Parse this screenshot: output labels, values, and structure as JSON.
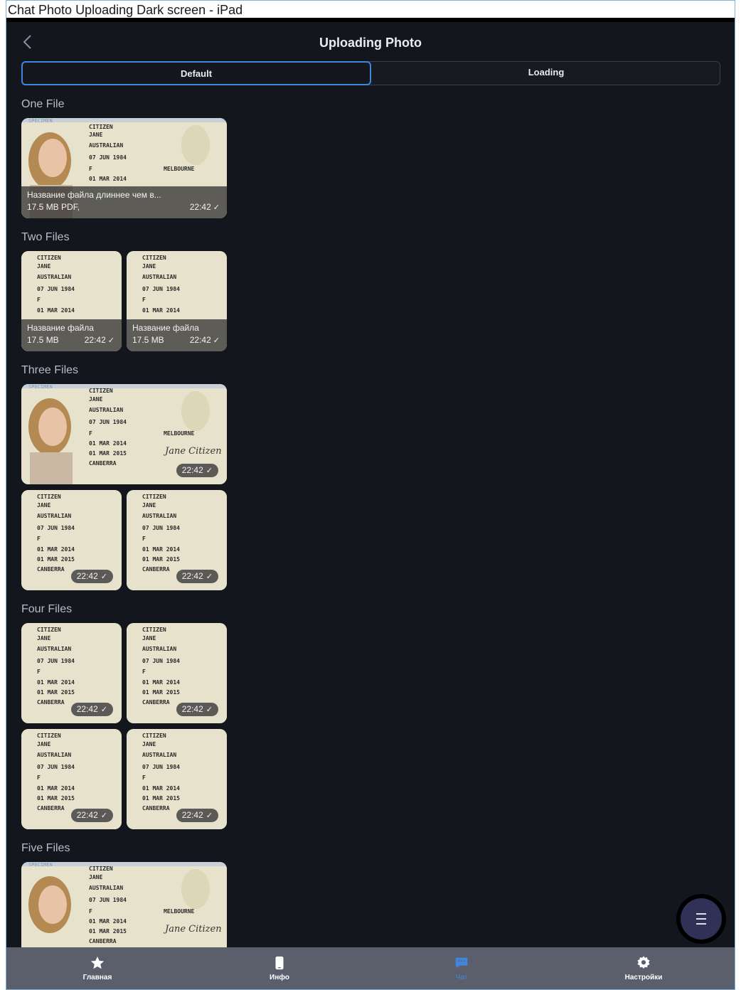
{
  "window": {
    "title": "Chat Photo Uploading Dark screen - iPad"
  },
  "header": {
    "title": "Uploading Photo",
    "back_icon": "chevron-left-icon"
  },
  "segments": {
    "default_label": "Default",
    "loading_label": "Loading"
  },
  "sections": {
    "one": "One File",
    "two": "Two Files",
    "three": "Three Files",
    "four": "Four Files",
    "five": "Five Files"
  },
  "files": {
    "one": {
      "name": "Название файла длиннее чем в...",
      "size": "17.5 MB PDF,",
      "time": "22:42"
    },
    "two_a": {
      "name": "Название файла",
      "size": "17.5 MB",
      "time": "22:42"
    },
    "two_b": {
      "name": "Название файла",
      "size": "17.5 MB",
      "time": "22:42"
    }
  },
  "time_label": "22:42",
  "card_text": {
    "specimen": "SPECIMEN",
    "citizen": "CITIZEN",
    "jane": "JANE",
    "australian": "AUSTRALIAN",
    "dob": "07 JUN 1984",
    "sex": "F",
    "issued": "01 MAR 2014",
    "expires": "01 MAR 2015",
    "place": "MELBOURNE",
    "city": "CANBERRA",
    "signature": "Jane Citizen"
  },
  "fab": {
    "icon": "menu-icon"
  },
  "tabbar": {
    "items": [
      {
        "label": "Главная",
        "icon": "star-icon"
      },
      {
        "label": "Инфо",
        "icon": "phone-icon"
      },
      {
        "label": "Чат",
        "icon": "chat-icon"
      },
      {
        "label": "Настройки",
        "icon": "gear-icon"
      }
    ]
  },
  "colors": {
    "accent": "#3f86e0",
    "background": "#13161d",
    "tabbar": "#5b5f6b",
    "fab": "#2f3256"
  }
}
